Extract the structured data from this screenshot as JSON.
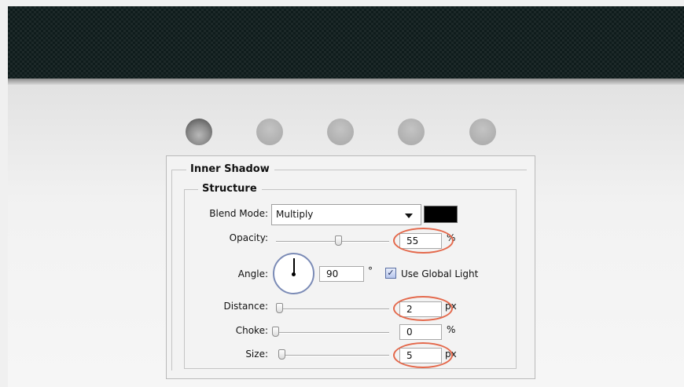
{
  "dots": [
    {
      "name": "dot-1",
      "state": "active"
    },
    {
      "name": "dot-2",
      "state": "inactive"
    },
    {
      "name": "dot-3",
      "state": "inactive"
    },
    {
      "name": "dot-4",
      "state": "inactive"
    },
    {
      "name": "dot-5",
      "state": "inactive"
    }
  ],
  "dialog": {
    "section_title": "Inner Shadow",
    "group_title": "Structure",
    "blend_mode": {
      "label": "Blend Mode:",
      "value": "Multiply",
      "color": "#000000"
    },
    "opacity": {
      "label": "Opacity:",
      "value": "55",
      "unit": "%",
      "slider_fraction": 0.55
    },
    "angle": {
      "label": "Angle:",
      "value": "90",
      "unit": "°",
      "dial_degrees": 90
    },
    "use_global_light": {
      "label": "Use Global Light",
      "checked": true
    },
    "distance": {
      "label": "Distance:",
      "value": "2",
      "unit": "px"
    },
    "choke": {
      "label": "Choke:",
      "value": "0",
      "unit": "%"
    },
    "size": {
      "label": "Size:",
      "value": "5",
      "unit": "px"
    }
  },
  "highlight_color": "#e4694c"
}
